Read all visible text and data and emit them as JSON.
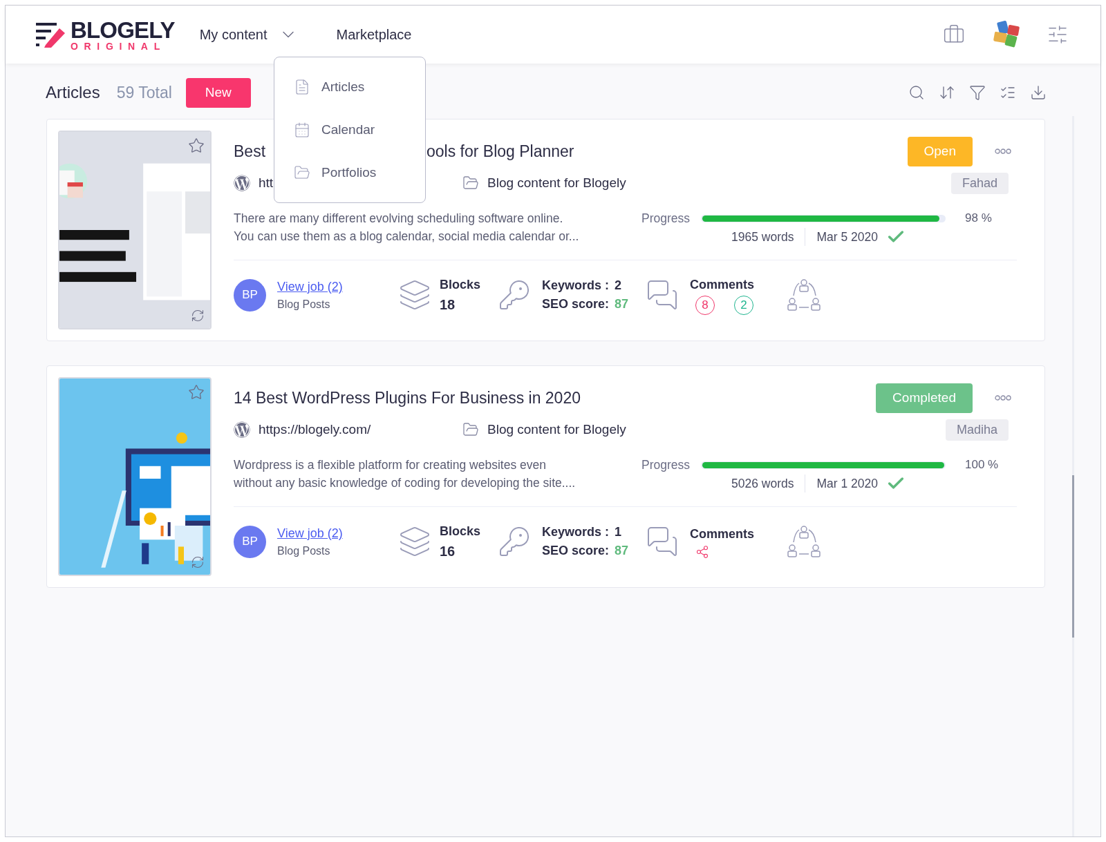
{
  "brand": {
    "name": "BLOGELY",
    "sub": "ORIGINAL"
  },
  "nav": [
    {
      "label": "My content",
      "kind": "dropdown",
      "expanded": true
    },
    {
      "label": "Marketplace",
      "kind": "link"
    }
  ],
  "dropdown": [
    {
      "label": "Articles"
    },
    {
      "label": "Calendar"
    },
    {
      "label": "Portfolios"
    }
  ],
  "toolbar": {
    "title": "Articles",
    "total": "59 Total",
    "new_button": "New"
  },
  "articles": [
    {
      "title_parts": [
        "Best",
        "ools for Blog Planner"
      ],
      "url": "htt",
      "project": "Blog content for Blogely",
      "description": [
        "There are many different evolving scheduling software online.",
        "You can use them as a blog calendar, social media calendar or..."
      ],
      "status": {
        "label": "Open",
        "kind": "open"
      },
      "author": "Fahad",
      "progress_label": "Progress",
      "level": 0.98,
      "percent": "98 %",
      "words": "1965 words",
      "date": "Mar 5 2020",
      "done": true,
      "avatar": "BP",
      "job_link": "View job (2)",
      "job_type": "Blog Posts",
      "blocks_label": "Blocks",
      "blocks": "18",
      "keywords_label": "Keywords :",
      "keywords": "2",
      "seo_label": "SEO score:",
      "seo": "87",
      "comments_label": "Comments",
      "comment_counts": [
        {
          "count": "8",
          "color": "#f0386b"
        },
        {
          "count": "2",
          "color": "#1fb58f"
        }
      ],
      "shared": false
    },
    {
      "title_parts": [
        "14 Best WordPress Plugins For Business in 2020"
      ],
      "url": "https://blogely.com/",
      "project": "Blog content for Blogely",
      "description": [
        "Wordpress is a flexible platform for creating websites even",
        "without any basic knowledge of coding for developing the site...."
      ],
      "status": {
        "label": "Completed",
        "kind": "completed"
      },
      "author": "Madiha",
      "progress_label": "Progress",
      "level": 1.0,
      "percent": "100 %",
      "words": "5026 words",
      "date": "Mar 1 2020",
      "done": true,
      "avatar": "BP",
      "job_link": "View job (2)",
      "job_type": "Blog Posts",
      "blocks_label": "Blocks",
      "blocks": "16",
      "keywords_label": "Keywords :",
      "keywords": "1",
      "seo_label": "SEO score:",
      "seo": "87",
      "comments_label": "Comments",
      "shared": true
    }
  ]
}
